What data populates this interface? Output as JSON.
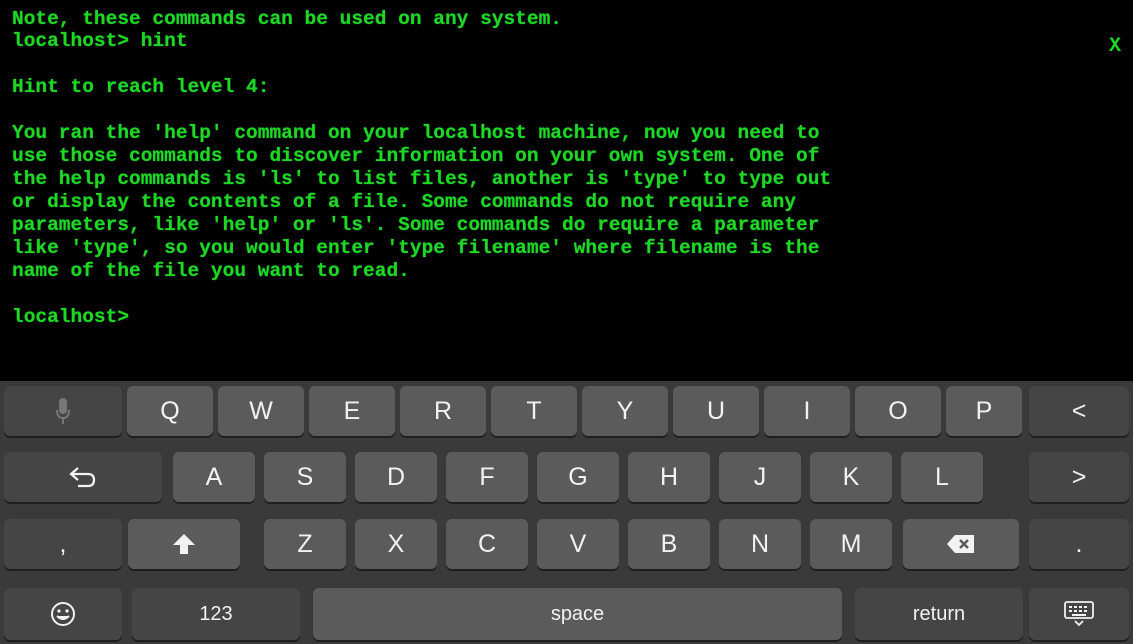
{
  "terminal": {
    "lines": [
      "Note, these commands can be used on any system.",
      "localhost> hint",
      "Hint to reach level 4:",
      "You ran the 'help' command on your localhost machine, now you need to",
      "use those commands to discover information on your own system. One of",
      "the help commands is 'ls' to list files, another is 'type' to type out",
      "or display the contents of a file. Some commands do not require any",
      "parameters, like 'help' or 'ls'. Some commands do require a parameter",
      "like 'type', so you would enter 'type filename' where filename is the",
      "name of the file you want to read.",
      "localhost>"
    ],
    "close_label": "X",
    "text_color": "#1fd81f",
    "background": "#000000"
  },
  "keyboard": {
    "row1": [
      "Q",
      "W",
      "E",
      "R",
      "T",
      "Y",
      "U",
      "I",
      "O",
      "P"
    ],
    "row2": [
      "A",
      "S",
      "D",
      "F",
      "G",
      "H",
      "J",
      "K",
      "L"
    ],
    "row3": [
      "Z",
      "X",
      "C",
      "V",
      "B",
      "N",
      "M"
    ],
    "comma": ",",
    "period": ".",
    "left_arrow": "<",
    "right_arrow": ">",
    "numbers_label": "123",
    "space_label": "space",
    "return_label": "return",
    "icons": {
      "mic": "microphone-icon",
      "undo": "undo-icon",
      "shift": "shift-icon",
      "backspace": "backspace-icon",
      "emoji": "emoji-icon",
      "hide_keyboard": "keyboard-dismiss-icon"
    }
  }
}
